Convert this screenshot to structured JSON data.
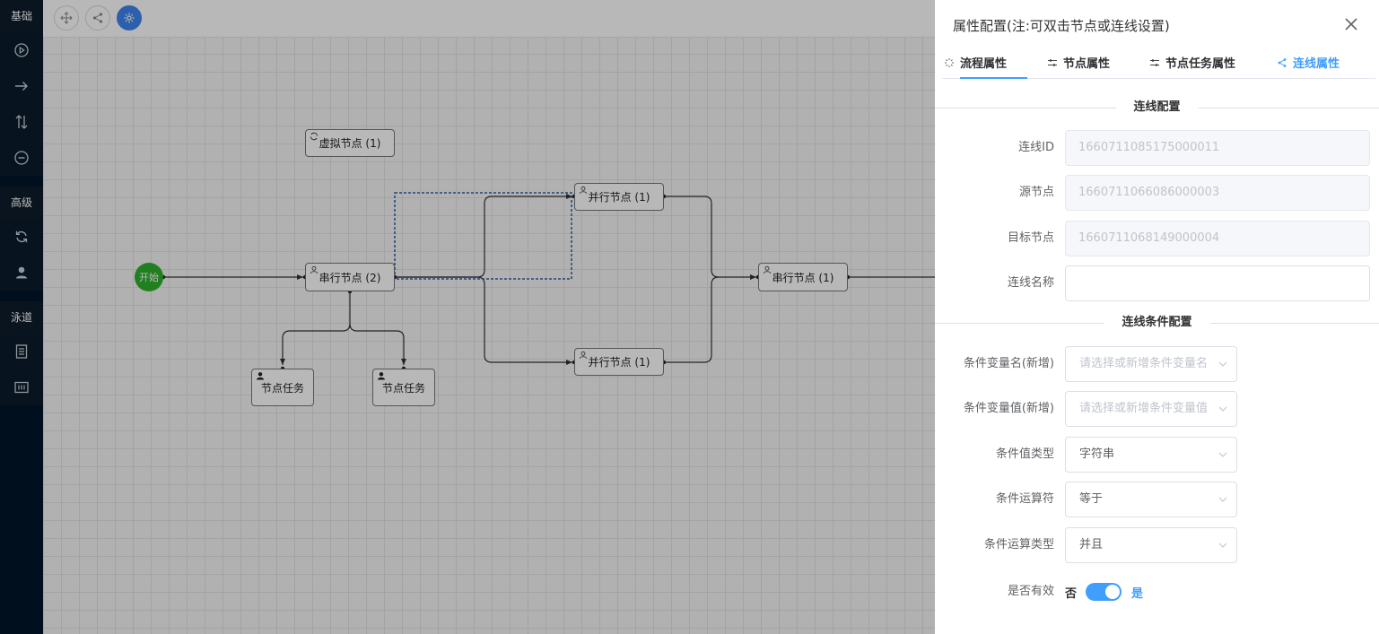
{
  "palette": {
    "groups": [
      "基础",
      "高级",
      "泳道"
    ]
  },
  "canvas": {
    "nodes": {
      "start": "开始",
      "virtual": "虚拟节点 (1)",
      "serial2": "串行节点 (2)",
      "parallel_top": "并行节点 (1)",
      "parallel_bottom": "并行节点 (1)",
      "serial1": "串行节点 (1)",
      "task_left": "节点任务",
      "task_right": "节点任务"
    }
  },
  "drawer": {
    "title": "属性配置(注:可双击节点或连线设置)",
    "tabs": [
      "流程属性",
      "节点属性",
      "节点任务属性",
      "连线属性"
    ],
    "section_line": "连线配置",
    "section_condition": "连线条件配置",
    "fields": {
      "line_id": {
        "label": "连线ID",
        "value": "1660711085175000011"
      },
      "source": {
        "label": "源节点",
        "value": "1660711066086000003"
      },
      "target": {
        "label": "目标节点",
        "value": "1660711068149000004"
      },
      "line_name": {
        "label": "连线名称",
        "value": ""
      }
    },
    "conditions": {
      "var_name": {
        "label": "条件变量名(新增)",
        "placeholder": "请选择或新增条件变量名"
      },
      "var_value": {
        "label": "条件变量值(新增)",
        "placeholder": "请选择或新增条件变量值"
      },
      "value_type": {
        "label": "条件值类型",
        "value": "字符串"
      },
      "operator": {
        "label": "条件运算符",
        "value": "等于"
      },
      "op_type": {
        "label": "条件运算类型",
        "value": "并且"
      }
    },
    "valid": {
      "label": "是否有效",
      "off": "否",
      "on": "是",
      "checked": true
    }
  },
  "colors": {
    "accent": "#409eff",
    "start": "#2fb12d",
    "palette_bg": "#001529"
  }
}
